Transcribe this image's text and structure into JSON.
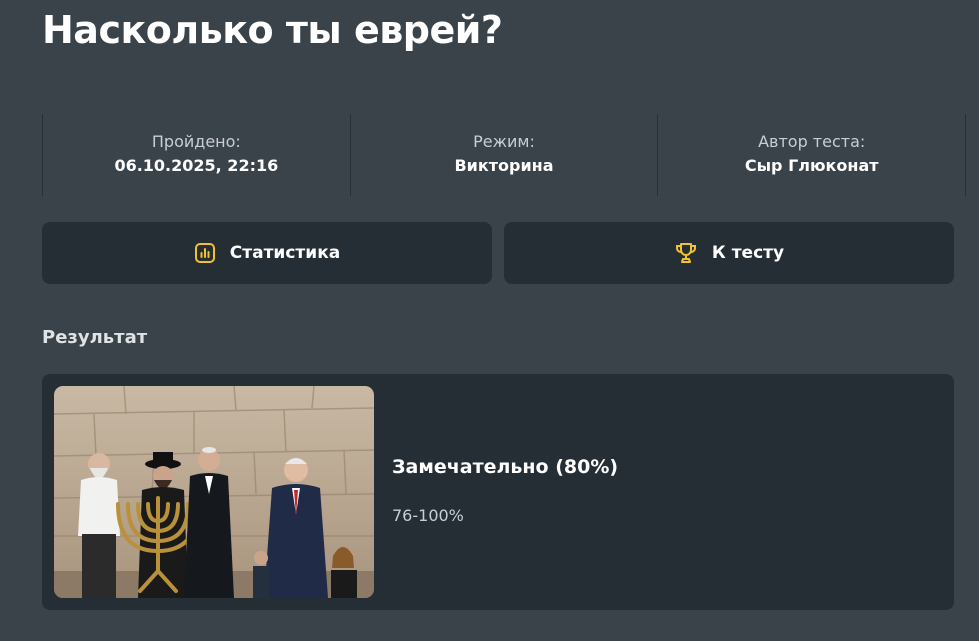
{
  "page": {
    "title": "Насколько ты еврей?"
  },
  "meta": [
    {
      "label": "Пройдено:",
      "value": "06.10.2025, 22:16"
    },
    {
      "label": "Режим:",
      "value": "Викторина"
    },
    {
      "label": "Автор теста:",
      "value": "Сыр Глюконат"
    }
  ],
  "actions": {
    "stats": {
      "label": "Статистика",
      "icon": "bar-chart-icon"
    },
    "test": {
      "label": "К тесту",
      "icon": "trophy-icon"
    }
  },
  "result": {
    "section_label": "Результат",
    "title": "Замечательно (80%)",
    "range": "76-100%"
  },
  "colors": {
    "background": "#3a434a",
    "card": "#262e35",
    "accent": "#f2c12e"
  }
}
